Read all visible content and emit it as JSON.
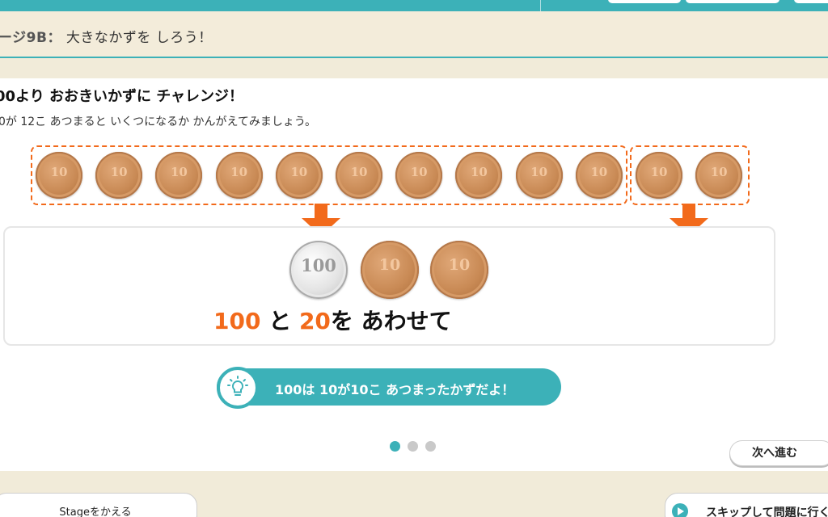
{
  "header": {
    "stage_id": "ージ9B：",
    "stage_title": "大きなかずを しろう！"
  },
  "lesson": {
    "heading": "00より おおきいかずに チャレンジ！",
    "instruction": "0が 12こ あつまると いくつになるか かんがえてみましょう。"
  },
  "coins": {
    "ten_label": "10",
    "hundred_label": "100",
    "top_row_count": 12
  },
  "result": {
    "num1": "100",
    "and": " と ",
    "num2": "20",
    "suffix": "を あわせて"
  },
  "hint": {
    "text": "100は 10が10こ あつまったかずだよ！"
  },
  "pagination": {
    "total": 3,
    "active": 1
  },
  "buttons": {
    "next": "次へ進む",
    "change_stage": "Stageをかえる",
    "skip": "スキップして問題に行く"
  },
  "colors": {
    "accent": "#3cb1b8",
    "highlight": "#f26a1b"
  }
}
